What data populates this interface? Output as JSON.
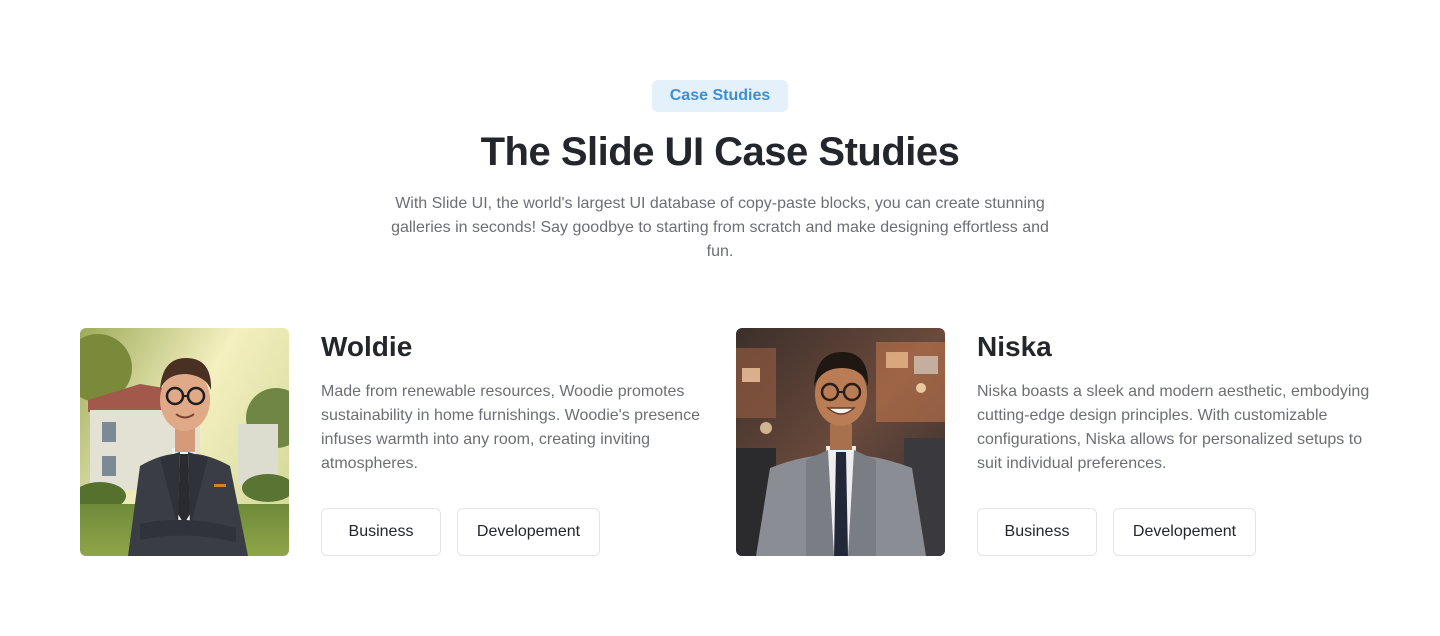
{
  "header": {
    "badge": "Case Studies",
    "title": "The Slide UI Case Studies",
    "subtitle": "With Slide UI, the world's largest UI database of copy-paste blocks, you can create stunning galleries in seconds! Say goodbye to starting from scratch and make designing effortless and fun."
  },
  "cards": [
    {
      "name": "Woldie",
      "description": "Made from renewable resources, Woodie promotes sustainability in home furnishings. Woodie's presence infuses warmth into any room, creating inviting atmospheres.",
      "tags": [
        "Business",
        "Developement"
      ],
      "photo_icon": "man-in-suit-outdoors"
    },
    {
      "name": "Niska",
      "description": "Niska boasts a sleek and modern aesthetic, embodying cutting-edge design principles. With customizable configurations, Niska allows for personalized setups to suit individual preferences.",
      "tags": [
        "Business",
        "Developement"
      ],
      "photo_icon": "man-in-suit-indoors"
    }
  ],
  "colors": {
    "badge_bg": "#e4f1fb",
    "badge_text": "#3d8fd1",
    "heading": "#23272b",
    "body_text": "#6b6f74",
    "tag_border": "#e3e5e8"
  }
}
